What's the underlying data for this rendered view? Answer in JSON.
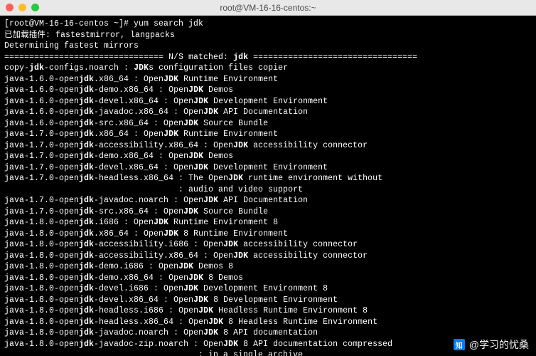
{
  "window": {
    "title": "root@VM-16-16-centos:~"
  },
  "prompt": {
    "user_host": "[root@VM-16-16-centos ~]#",
    "command": " yum search jdk"
  },
  "preamble": [
    "已加载插件: fastestmirror, langpacks",
    "Determining fastest mirrors"
  ],
  "match_header": {
    "left": "================================ N/S matched: ",
    "term": "jdk",
    "right": " ================================="
  },
  "results": [
    {
      "pre": "copy-",
      "b1": "jdk",
      "mid1": "-configs.noarch : ",
      "b2": "JDK",
      "post": "s configuration files copier"
    },
    {
      "pre": "java-1.6.0-open",
      "b1": "jdk",
      "mid1": ".x86_64 : Open",
      "b2": "JDK",
      "post": " Runtime Environment"
    },
    {
      "pre": "java-1.6.0-open",
      "b1": "jdk",
      "mid1": "-demo.x86_64 : Open",
      "b2": "JDK",
      "post": " Demos"
    },
    {
      "pre": "java-1.6.0-open",
      "b1": "jdk",
      "mid1": "-devel.x86_64 : Open",
      "b2": "JDK",
      "post": " Development Environment"
    },
    {
      "pre": "java-1.6.0-open",
      "b1": "jdk",
      "mid1": "-javadoc.x86_64 : Open",
      "b2": "JDK",
      "post": " API Documentation"
    },
    {
      "pre": "java-1.6.0-open",
      "b1": "jdk",
      "mid1": "-src.x86_64 : Open",
      "b2": "JDK",
      "post": " Source Bundle"
    },
    {
      "pre": "java-1.7.0-open",
      "b1": "jdk",
      "mid1": ".x86_64 : Open",
      "b2": "JDK",
      "post": " Runtime Environment"
    },
    {
      "pre": "java-1.7.0-open",
      "b1": "jdk",
      "mid1": "-accessibility.x86_64 : Open",
      "b2": "JDK",
      "post": " accessibility connector"
    },
    {
      "pre": "java-1.7.0-open",
      "b1": "jdk",
      "mid1": "-demo.x86_64 : Open",
      "b2": "JDK",
      "post": " Demos"
    },
    {
      "pre": "java-1.7.0-open",
      "b1": "jdk",
      "mid1": "-devel.x86_64 : Open",
      "b2": "JDK",
      "post": " Development Environment"
    },
    {
      "pre": "java-1.7.0-open",
      "b1": "jdk",
      "mid1": "-headless.x86_64 : The Open",
      "b2": "JDK",
      "post": " runtime environment without"
    },
    {
      "raw": "                                   : audio and video support"
    },
    {
      "pre": "java-1.7.0-open",
      "b1": "jdk",
      "mid1": "-javadoc.noarch : Open",
      "b2": "JDK",
      "post": " API Documentation"
    },
    {
      "pre": "java-1.7.0-open",
      "b1": "jdk",
      "mid1": "-src.x86_64 : Open",
      "b2": "JDK",
      "post": " Source Bundle"
    },
    {
      "pre": "java-1.8.0-open",
      "b1": "jdk",
      "mid1": ".i686 : Open",
      "b2": "JDK",
      "post": " Runtime Environment 8"
    },
    {
      "pre": "java-1.8.0-open",
      "b1": "jdk",
      "mid1": ".x86_64 : Open",
      "b2": "JDK",
      "post": " 8 Runtime Environment"
    },
    {
      "pre": "java-1.8.0-open",
      "b1": "jdk",
      "mid1": "-accessibility.i686 : Open",
      "b2": "JDK",
      "post": " accessibility connector"
    },
    {
      "pre": "java-1.8.0-open",
      "b1": "jdk",
      "mid1": "-accessibility.x86_64 : Open",
      "b2": "JDK",
      "post": " accessibility connector"
    },
    {
      "pre": "java-1.8.0-open",
      "b1": "jdk",
      "mid1": "-demo.i686 : Open",
      "b2": "JDK",
      "post": " Demos 8"
    },
    {
      "pre": "java-1.8.0-open",
      "b1": "jdk",
      "mid1": "-demo.x86_64 : Open",
      "b2": "JDK",
      "post": " 8 Demos"
    },
    {
      "pre": "java-1.8.0-open",
      "b1": "jdk",
      "mid1": "-devel.i686 : Open",
      "b2": "JDK",
      "post": " Development Environment 8"
    },
    {
      "pre": "java-1.8.0-open",
      "b1": "jdk",
      "mid1": "-devel.x86_64 : Open",
      "b2": "JDK",
      "post": " 8 Development Environment"
    },
    {
      "pre": "java-1.8.0-open",
      "b1": "jdk",
      "mid1": "-headless.i686 : Open",
      "b2": "JDK",
      "post": " Headless Runtime Environment 8"
    },
    {
      "pre": "java-1.8.0-open",
      "b1": "jdk",
      "mid1": "-headless.x86_64 : Open",
      "b2": "JDK",
      "post": " 8 Headless Runtime Environment"
    },
    {
      "pre": "java-1.8.0-open",
      "b1": "jdk",
      "mid1": "-javadoc.noarch : Open",
      "b2": "JDK",
      "post": " 8 API documentation"
    },
    {
      "pre": "java-1.8.0-open",
      "b1": "jdk",
      "mid1": "-javadoc-zip.noarch : Open",
      "b2": "JDK",
      "post": " 8 API documentation compressed"
    },
    {
      "raw": "                                       : in a single archive"
    }
  ],
  "watermark": {
    "icon": "知",
    "text": "@学习的忧桑"
  }
}
